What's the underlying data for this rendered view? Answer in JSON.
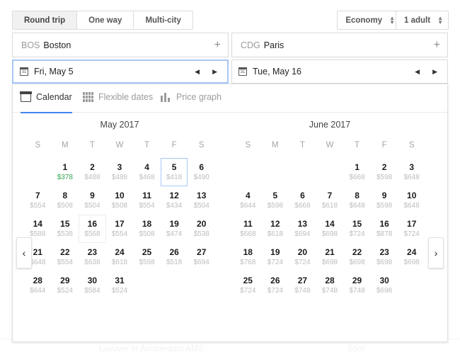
{
  "toolbar": {
    "trip_types": [
      {
        "label": "Round trip",
        "active": true
      },
      {
        "label": "One way",
        "active": false
      },
      {
        "label": "Multi-city",
        "active": false
      }
    ],
    "cabin": "Economy",
    "passengers": "1 adult"
  },
  "search": {
    "origin": {
      "code": "BOS",
      "city": "Boston",
      "add": "+"
    },
    "destination": {
      "code": "CDG",
      "city": "Paris",
      "add": "+"
    },
    "depart": {
      "label": "Fri, May 5",
      "prev": "◀",
      "next": "▶"
    },
    "return": {
      "label": "Tue, May 16",
      "prev": "◀",
      "next": "▶"
    }
  },
  "tabs": [
    {
      "label": "Calendar",
      "icon": "calendar-icon",
      "active": true
    },
    {
      "label": "Flexible dates",
      "icon": "grid-icon",
      "active": false
    },
    {
      "label": "Price graph",
      "icon": "bar-chart-icon",
      "active": false
    }
  ],
  "nav": {
    "prev": "‹",
    "next": "›"
  },
  "dow": [
    "S",
    "M",
    "T",
    "W",
    "T",
    "F",
    "S"
  ],
  "months": [
    {
      "title": "May 2017",
      "lead_blanks": 1,
      "days": [
        {
          "n": 1,
          "price": "$378",
          "cheapest": true
        },
        {
          "n": 2,
          "price": "$488"
        },
        {
          "n": 3,
          "price": "$488"
        },
        {
          "n": 4,
          "price": "$468"
        },
        {
          "n": 5,
          "price": "$418",
          "selected": true
        },
        {
          "n": 6,
          "price": "$490"
        },
        {
          "n": 7,
          "price": "$554"
        },
        {
          "n": 8,
          "price": "$508"
        },
        {
          "n": 9,
          "price": "$504"
        },
        {
          "n": 10,
          "price": "$508"
        },
        {
          "n": 11,
          "price": "$554"
        },
        {
          "n": 12,
          "price": "$434"
        },
        {
          "n": 13,
          "price": "$504"
        },
        {
          "n": 14,
          "price": "$588"
        },
        {
          "n": 15,
          "price": "$538"
        },
        {
          "n": 16,
          "price": "$568",
          "hovered": true
        },
        {
          "n": 17,
          "price": "$554"
        },
        {
          "n": 18,
          "price": "$508"
        },
        {
          "n": 19,
          "price": "$474"
        },
        {
          "n": 20,
          "price": "$538"
        },
        {
          "n": 21,
          "price": "$648"
        },
        {
          "n": 22,
          "price": "$554"
        },
        {
          "n": 23,
          "price": "$638"
        },
        {
          "n": 24,
          "price": "$618"
        },
        {
          "n": 25,
          "price": "$598"
        },
        {
          "n": 26,
          "price": "$518"
        },
        {
          "n": 27,
          "price": "$694"
        },
        {
          "n": 28,
          "price": "$644"
        },
        {
          "n": 29,
          "price": "$524"
        },
        {
          "n": 30,
          "price": "$584"
        },
        {
          "n": 31,
          "price": "$524"
        }
      ]
    },
    {
      "title": "June 2017",
      "lead_blanks": 4,
      "days": [
        {
          "n": 1,
          "price": "$668"
        },
        {
          "n": 2,
          "price": "$598"
        },
        {
          "n": 3,
          "price": "$648"
        },
        {
          "n": 4,
          "price": "$644"
        },
        {
          "n": 5,
          "price": "$598"
        },
        {
          "n": 6,
          "price": "$668"
        },
        {
          "n": 7,
          "price": "$618"
        },
        {
          "n": 8,
          "price": "$648"
        },
        {
          "n": 9,
          "price": "$598"
        },
        {
          "n": 10,
          "price": "$648"
        },
        {
          "n": 11,
          "price": "$668"
        },
        {
          "n": 12,
          "price": "$618"
        },
        {
          "n": 13,
          "price": "$694"
        },
        {
          "n": 14,
          "price": "$698"
        },
        {
          "n": 15,
          "price": "$724"
        },
        {
          "n": 16,
          "price": "$878"
        },
        {
          "n": 17,
          "price": "$724"
        },
        {
          "n": 18,
          "price": "$768"
        },
        {
          "n": 19,
          "price": "$724"
        },
        {
          "n": 20,
          "price": "$724"
        },
        {
          "n": 21,
          "price": "$698"
        },
        {
          "n": 22,
          "price": "$698"
        },
        {
          "n": 23,
          "price": "$698"
        },
        {
          "n": 24,
          "price": "$698"
        },
        {
          "n": 25,
          "price": "$724"
        },
        {
          "n": 26,
          "price": "$724"
        },
        {
          "n": 27,
          "price": "$748"
        },
        {
          "n": 28,
          "price": "$748"
        },
        {
          "n": 29,
          "price": "$748"
        },
        {
          "n": 30,
          "price": "$698"
        }
      ]
    }
  ],
  "background_row": {
    "layover": "Layover in Amsterdam AMS",
    "duration": "55m"
  },
  "colors": {
    "accent": "#4285f4",
    "selection_border": "#a6c8f7",
    "cheapest": "#34a853",
    "price_text": "#bdbdbd"
  }
}
